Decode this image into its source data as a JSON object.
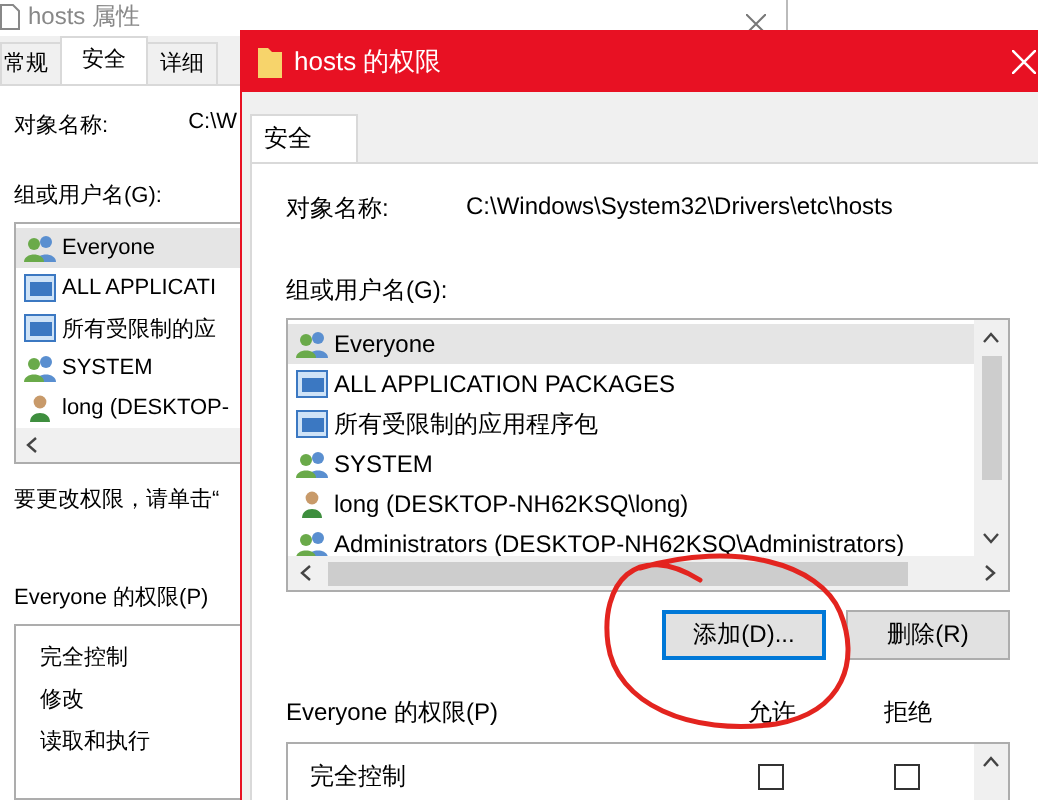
{
  "back_window": {
    "title": "hosts 属性",
    "tabs": [
      {
        "label": "常规",
        "selected": false
      },
      {
        "label": "安全",
        "selected": true
      },
      {
        "label": "详细",
        "selected": false
      }
    ],
    "object_label": "对象名称:",
    "object_value": "C:\\W",
    "group_label": "组或用户名(G):",
    "users": [
      {
        "name": "Everyone",
        "kind": "group",
        "selected": true
      },
      {
        "name": "ALL APPLICATI",
        "kind": "app",
        "selected": false
      },
      {
        "name": "所有受限制的应",
        "kind": "app",
        "selected": false
      },
      {
        "name": "SYSTEM",
        "kind": "group",
        "selected": false
      },
      {
        "name": "long (DESKTOP-",
        "kind": "user",
        "selected": false
      }
    ],
    "hint": "要更改权限，请单击“",
    "permissions_label": "Everyone 的权限(P)",
    "permissions": [
      "完全控制",
      "修改",
      "读取和执行"
    ]
  },
  "dialog": {
    "title": "hosts 的权限",
    "tabs": [
      {
        "label": "安全",
        "selected": true
      }
    ],
    "object_label": "对象名称:",
    "object_value": "C:\\Windows\\System32\\Drivers\\etc\\hosts",
    "group_label": "组或用户名(G):",
    "users": [
      {
        "name": "Everyone",
        "kind": "group",
        "selected": true
      },
      {
        "name": "ALL APPLICATION PACKAGES",
        "kind": "app",
        "selected": false
      },
      {
        "name": "所有受限制的应用程序包",
        "kind": "app",
        "selected": false
      },
      {
        "name": "SYSTEM",
        "kind": "group",
        "selected": false
      },
      {
        "name": "long (DESKTOP-NH62KSQ\\long)",
        "kind": "user",
        "selected": false
      },
      {
        "name": "Administrators (DESKTOP-NH62KSQ\\Administrators)",
        "kind": "group",
        "selected": false
      }
    ],
    "buttons": [
      {
        "label": "添加(D)...",
        "focused": true
      },
      {
        "label": "删除(R)",
        "focused": false
      }
    ],
    "permissions_label": "Everyone 的权限(P)",
    "columns": [
      "允许",
      "拒绝"
    ],
    "permissions": [
      {
        "name": "完全控制",
        "allow": false,
        "deny": false
      }
    ]
  }
}
